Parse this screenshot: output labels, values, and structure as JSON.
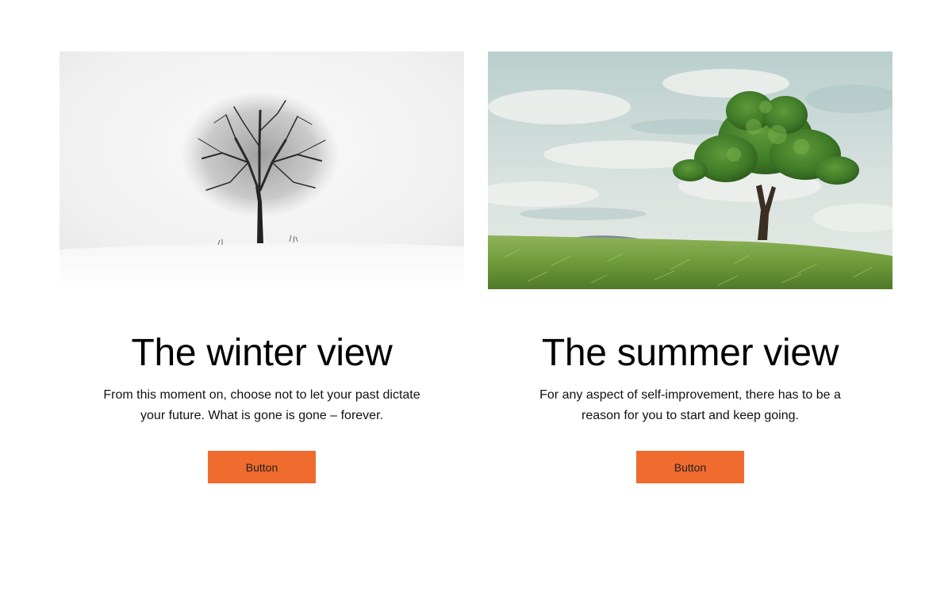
{
  "cards": [
    {
      "title": "The winter view",
      "text": "From this moment on, choose not to let your past dictate your future. What is gone is gone – forever.",
      "button_label": "Button",
      "image": "winter-tree-photo"
    },
    {
      "title": "The summer view",
      "text": "For any aspect of self-improvement, there has to be a reason for you to start and keep going.",
      "button_label": "Button",
      "image": "summer-tree-photo"
    }
  ],
  "colors": {
    "accent": "#ef6b2e",
    "background": "#ffffff",
    "text": "#000000"
  }
}
